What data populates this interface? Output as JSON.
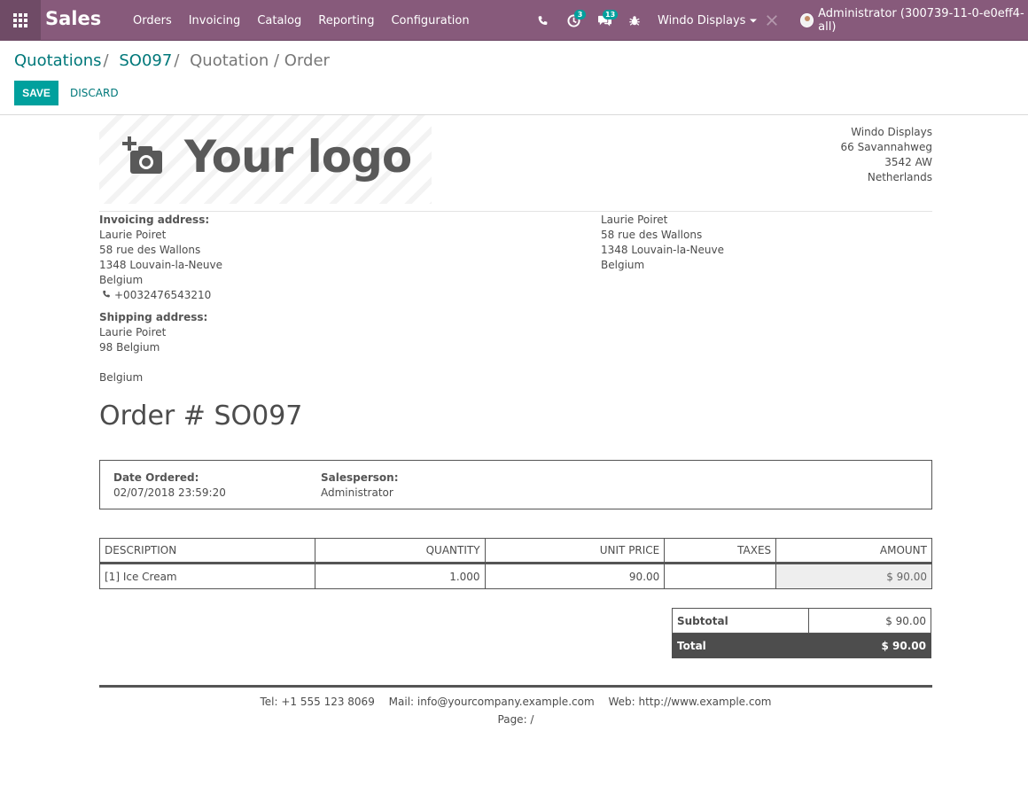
{
  "nav": {
    "app_title": "Sales",
    "menu": [
      "Orders",
      "Invoicing",
      "Catalog",
      "Reporting",
      "Configuration"
    ],
    "activity_count": "3",
    "messages_count": "13",
    "company_switch": "Windo Displays",
    "user": "Administrator (300739-11-0-e0eff4-all)"
  },
  "breadcrumb": {
    "item1": "Quotations",
    "item2": "SO097",
    "current": "Quotation / Order"
  },
  "buttons": {
    "save": "SAVE",
    "discard": "DISCARD"
  },
  "report": {
    "logo_text": "Your logo",
    "company": {
      "name": "Windo Displays",
      "street": "66 Savannahweg",
      "city": "3542 AW",
      "country": "Netherlands"
    },
    "invoicing": {
      "label": "Invoicing address:",
      "name": "Laurie Poiret",
      "street": "58 rue des Wallons",
      "city": "1348 Louvain-la-Neuve",
      "country": "Belgium",
      "phone": "+0032476543210"
    },
    "shipping": {
      "label": "Shipping address:",
      "name": "Laurie Poiret",
      "street": "98 Belgium",
      "country": "Belgium"
    },
    "partner": {
      "name": "Laurie Poiret",
      "street": "58 rue des Wallons",
      "city": "1348 Louvain-la-Neuve",
      "country": "Belgium"
    },
    "title": "Order # SO097",
    "info": {
      "date_label": "Date Ordered:",
      "date_value": "02/07/2018 23:59:20",
      "sales_label": "Salesperson:",
      "sales_value": "Administrator"
    },
    "columns": [
      "DESCRIPTION",
      "QUANTITY",
      "UNIT PRICE",
      "TAXES",
      "AMOUNT"
    ],
    "lines": [
      {
        "description": "[1] Ice Cream",
        "quantity": "1.000",
        "unit_price": "90.00",
        "taxes": "",
        "amount": "$ 90.00"
      }
    ],
    "subtotal_label": "Subtotal",
    "subtotal_value": "$ 90.00",
    "total_label": "Total",
    "total_value": "$ 90.00",
    "footer": {
      "tel": "Tel: +1 555 123 8069",
      "mail": "Mail: info@yourcompany.example.com",
      "web": "Web: http://www.example.com",
      "page": "Page: /"
    }
  }
}
